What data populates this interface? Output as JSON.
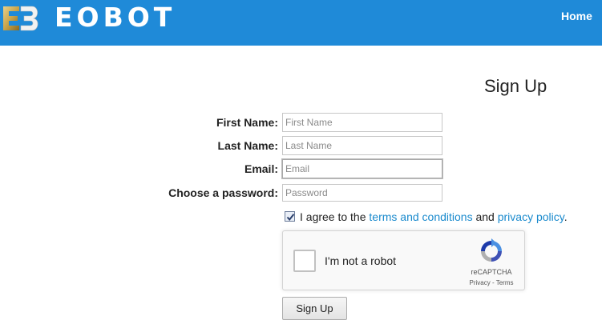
{
  "header": {
    "brand": "EOBOT",
    "nav_home": "Home",
    "logo_text": "EB"
  },
  "page": {
    "title": "Sign Up"
  },
  "form": {
    "first_name": {
      "label": "First Name:",
      "placeholder": "First Name",
      "value": ""
    },
    "last_name": {
      "label": "Last Name:",
      "placeholder": "Last Name",
      "value": ""
    },
    "email": {
      "label": "Email:",
      "placeholder": "Email",
      "value": ""
    },
    "password": {
      "label": "Choose a password:",
      "placeholder": "Password",
      "value": ""
    }
  },
  "agreement": {
    "checked": true,
    "prefix": "I agree to the",
    "terms_link": "terms and conditions",
    "middle": "and",
    "privacy_link": "privacy policy",
    "suffix": "."
  },
  "recaptcha": {
    "label": "I'm not a robot",
    "brand": "reCAPTCHA",
    "privacy": "Privacy",
    "separator": " - ",
    "terms": "Terms"
  },
  "submit": {
    "label": "Sign Up"
  },
  "colors": {
    "header_bg": "#1f8ad8",
    "link": "#1a8acd",
    "logo_gold": "#c9a44a"
  },
  "icons": {
    "logo": "eb-logo-icon",
    "checkbox": "checkmark-icon",
    "recaptcha": "recaptcha-logo-icon"
  }
}
